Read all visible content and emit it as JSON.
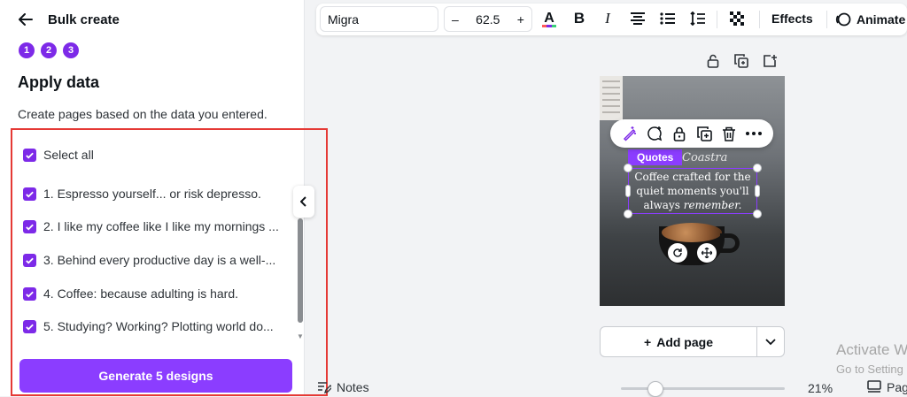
{
  "panel": {
    "title": "Bulk create",
    "steps": [
      "1",
      "2",
      "3"
    ],
    "heading": "Apply data",
    "description": "Create pages based on the data you entered.",
    "select_all": "Select all",
    "items": [
      "1. Espresso yourself... or risk depresso.",
      "2. I like my coffee like I like my mornings ...",
      "3. Behind every productive day is a well-...",
      "4. Coffee: because adulting is hard.",
      "5. Studying? Working? Plotting world do..."
    ],
    "generate_label": "Generate 5 designs"
  },
  "toolbar": {
    "font": "Migra",
    "size": "62.5",
    "minus": "–",
    "plus": "+",
    "effects": "Effects",
    "animate": "Animate"
  },
  "canvas": {
    "element_label": "Quotes",
    "script_word": "Coastra",
    "quote_line1": "Coffee crafted for the",
    "quote_line2": "quiet moments you'll",
    "quote_line3a": "always ",
    "quote_line3b": "remember.",
    "add_page": "Add page"
  },
  "watermark": {
    "title": "Activate W",
    "sub": "Go to Setting"
  },
  "bottom": {
    "notes": "Notes",
    "zoom": "21%",
    "pages": "Pag"
  },
  "colors": {
    "accent": "#8b3dff",
    "checkbox": "#7d2ae8",
    "highlight_border": "#e53935"
  }
}
